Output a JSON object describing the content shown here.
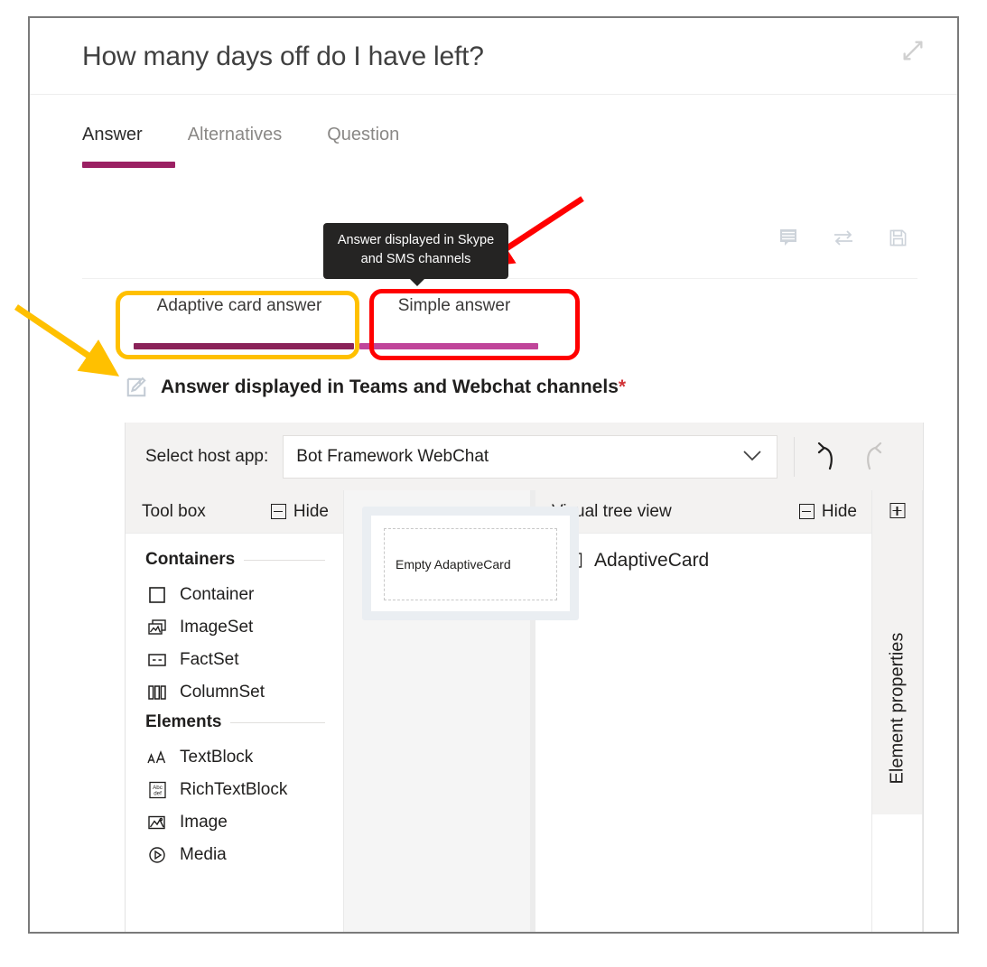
{
  "header": {
    "title": "How many days off do I have left?",
    "expand_icon": "expand-collapse-icon"
  },
  "main_tabs": [
    {
      "label": "Answer",
      "active": true
    },
    {
      "label": "Alternatives",
      "active": false
    },
    {
      "label": "Question",
      "active": false
    }
  ],
  "toolbar": {
    "icons": [
      {
        "name": "chat-lines-icon"
      },
      {
        "name": "swap-arrows-icon"
      },
      {
        "name": "save-floppy-icon"
      }
    ]
  },
  "tooltip": {
    "text": "Answer displayed in Skype and SMS channels"
  },
  "sub_tabs": [
    {
      "label": "Adaptive card answer",
      "underline_color": "#8a2259",
      "highlight": "#ffc000"
    },
    {
      "label": "Simple answer",
      "underline_color": "#c0459a",
      "highlight": "#ff0000"
    }
  ],
  "section": {
    "edit_icon": "edit-pencil-square-icon",
    "heading": "Answer displayed in Teams and Webchat channels",
    "required_marker": "*"
  },
  "designer": {
    "host_app": {
      "label": "Select host app:",
      "value": "Bot Framework WebChat",
      "chevron_icon": "chevron-down-icon",
      "undo_icon": "undo-arrow-icon",
      "redo_icon": "redo-arrow-icon"
    },
    "toolbox": {
      "title": "Tool box",
      "hide_label": "Hide",
      "groups": [
        {
          "title": "Containers",
          "items": [
            {
              "label": "Container",
              "icon": "container-square-icon"
            },
            {
              "label": "ImageSet",
              "icon": "image-set-icon"
            },
            {
              "label": "FactSet",
              "icon": "fact-set-icon"
            },
            {
              "label": "ColumnSet",
              "icon": "column-set-icon"
            }
          ]
        },
        {
          "title": "Elements",
          "items": [
            {
              "label": "TextBlock",
              "icon": "text-block-icon"
            },
            {
              "label": "RichTextBlock",
              "icon": "rich-text-block-icon"
            },
            {
              "label": "Image",
              "icon": "image-icon"
            },
            {
              "label": "Media",
              "icon": "media-play-icon"
            }
          ]
        }
      ]
    },
    "canvas": {
      "placeholder": "Empty AdaptiveCard"
    },
    "tree": {
      "title": "Visual tree view",
      "hide_label": "Hide",
      "nodes": [
        {
          "label": "AdaptiveCard",
          "icon": "adaptive-card-icon"
        }
      ]
    },
    "properties": {
      "label": "Element properties",
      "expand_icon": "expand-plus-icon"
    }
  },
  "annotations": {
    "red_arrow": "red-arrow-pointing-to-tooltip",
    "yellow_arrow": "yellow-arrow-pointing-to-edit-icon",
    "yellow_box": "#ffc000",
    "red_box": "#ff0000"
  }
}
